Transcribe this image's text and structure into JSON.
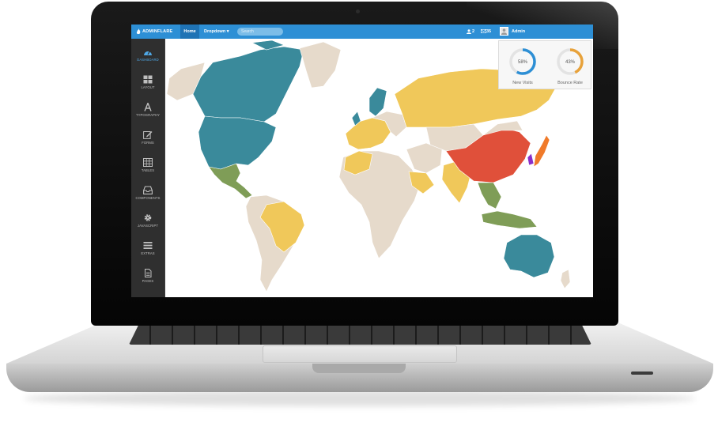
{
  "topbar": {
    "brand": "ADMINFLARE",
    "nav": [
      {
        "label": "Home",
        "active": true
      },
      {
        "label": "Dropdown ▾",
        "active": false
      }
    ],
    "search_placeholder": "Search",
    "users_count": "2",
    "messages_count": "35",
    "user_name": "Admin"
  },
  "sidebar": {
    "items": [
      {
        "label": "DASHBOARD",
        "icon": "dashboard-icon",
        "active": true
      },
      {
        "label": "LAYOUT",
        "icon": "layout-icon"
      },
      {
        "label": "TYPOGRAPHY",
        "icon": "typography-icon"
      },
      {
        "label": "FORMS",
        "icon": "edit-icon"
      },
      {
        "label": "TABLES",
        "icon": "table-icon"
      },
      {
        "label": "COMPONENTS",
        "icon": "inbox-icon"
      },
      {
        "label": "JAVASCRIPT",
        "icon": "gear-icon"
      },
      {
        "label": "EXTRAS",
        "icon": "menu-icon"
      },
      {
        "label": "PAGES",
        "icon": "file-icon"
      }
    ]
  },
  "stats": [
    {
      "label": "New Visits",
      "value": "58%",
      "percent": 58,
      "color": "#2d8fd5"
    },
    {
      "label": "Bounce Rate",
      "value": "43%",
      "percent": 43,
      "color": "#e8a23a"
    }
  ],
  "map_colors": {
    "teal": "#3a8a9b",
    "yellow": "#f0c85a",
    "beige": "#e6dacb",
    "red": "#e0503a",
    "orange": "#f07a2a",
    "green": "#7f9d57",
    "purple": "#8a2fc8"
  }
}
